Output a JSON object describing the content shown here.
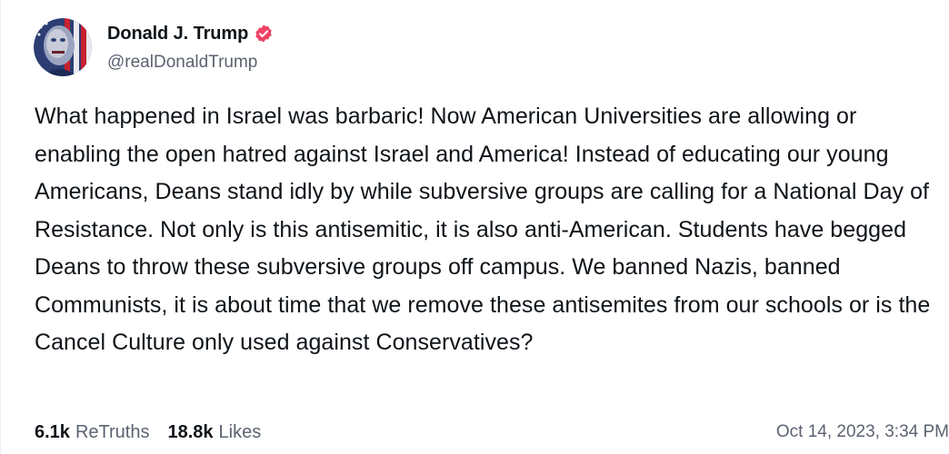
{
  "author": {
    "display_name": "Donald J. Trump",
    "handle": "@realDonaldTrump",
    "verified_badge_icon": "verified-badge-icon",
    "badge_color": "#f04366"
  },
  "post": {
    "text": "What happened in Israel was barbaric! Now American Universities are allowing or enabling the open hatred against Israel and America! Instead of educating our young Americans, Deans stand idly by while subversive groups are calling for a National Day of Resistance. Not only is this antisemitic, it is also anti-American. Students have begged Deans to throw these subversive groups off campus. We banned Nazis, banned Communists, it is about time that we remove these antisemites from our schools or is the Cancel Culture only used against Conservatives?"
  },
  "stats": {
    "retruths_count": "6.1k",
    "retruths_label": "ReTruths",
    "likes_count": "18.8k",
    "likes_label": "Likes",
    "timestamp": "Oct 14, 2023, 3:34 PM"
  }
}
